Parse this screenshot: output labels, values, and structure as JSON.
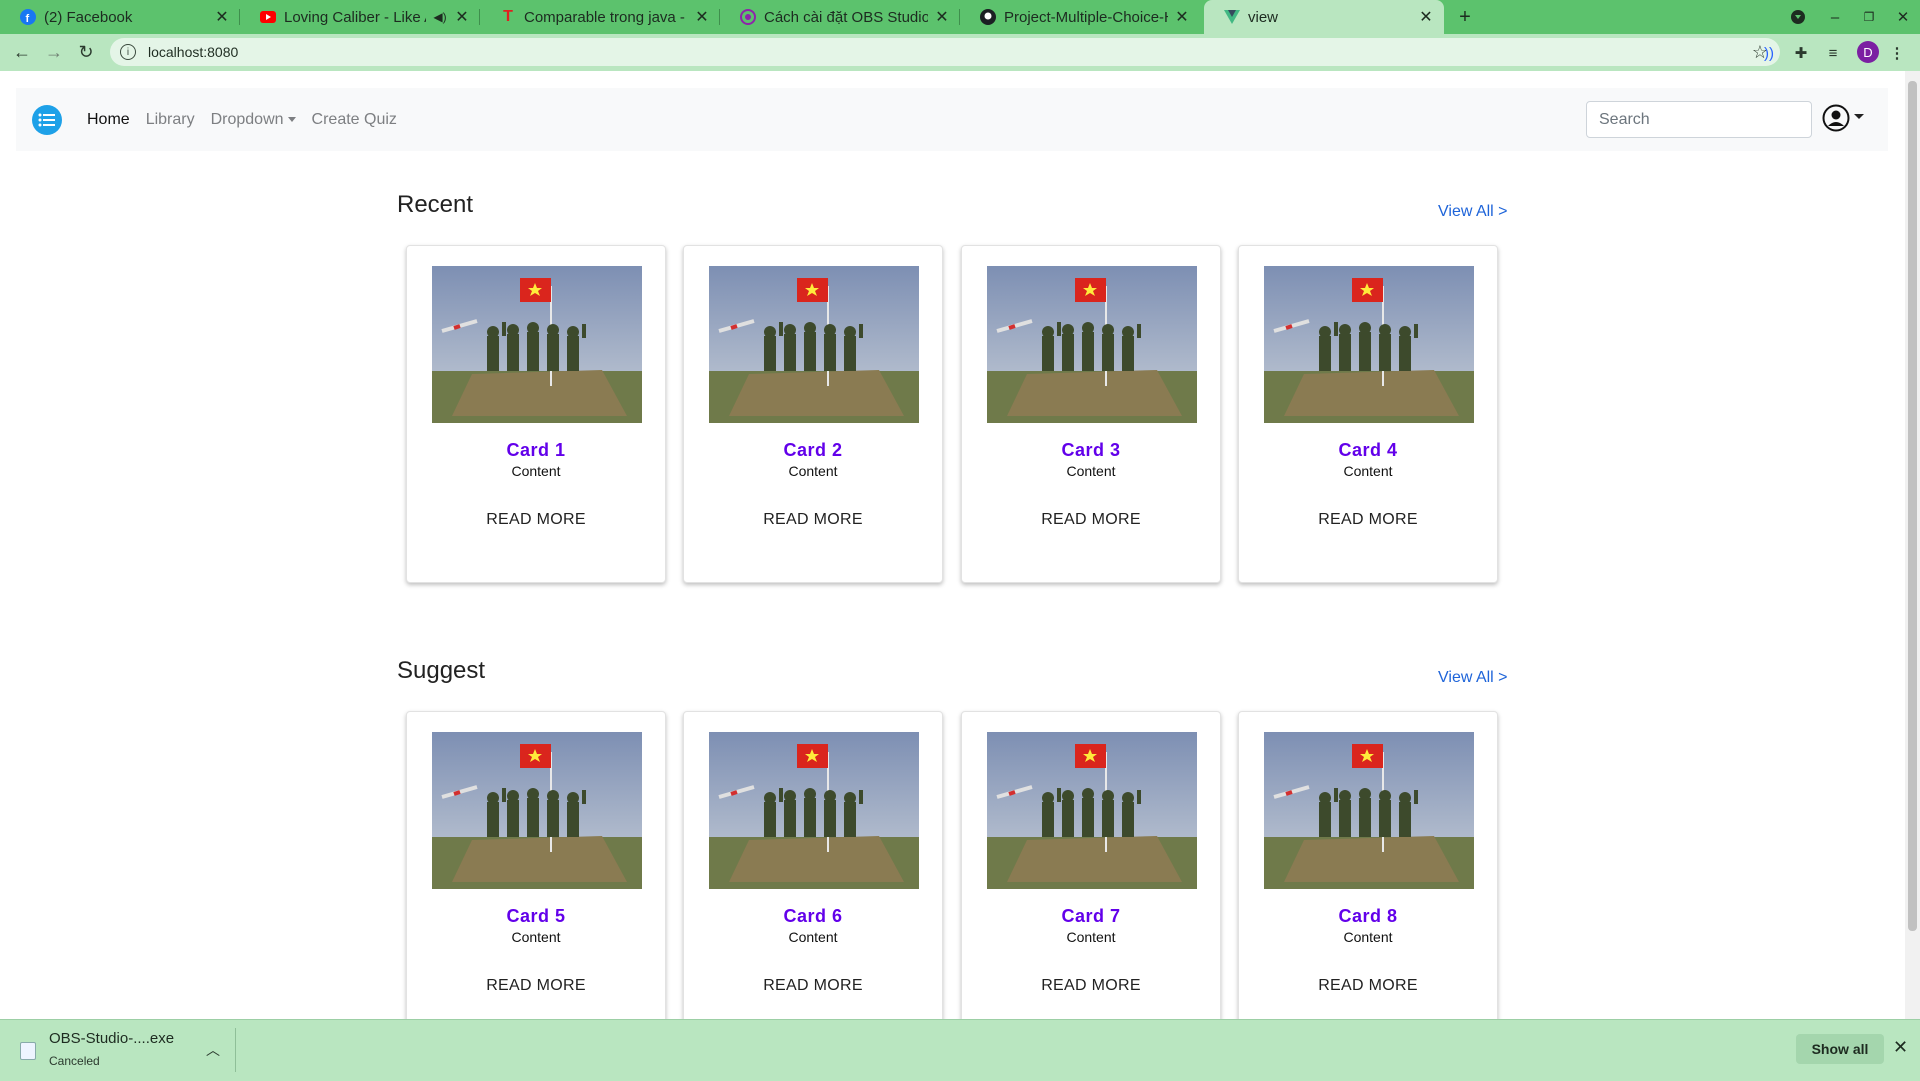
{
  "browser": {
    "tabs": [
      {
        "title": "(2) Facebook",
        "icon": "facebook-icon"
      },
      {
        "title": "Loving Caliber - Like A",
        "icon": "youtube-icon"
      },
      {
        "title": "Comparable trong java - V",
        "icon": "t-icon"
      },
      {
        "title": "Cách cài đặt OBS Studio t",
        "icon": "obs-icon"
      },
      {
        "title": "Project-Multiple-Choice-H",
        "icon": "github-icon"
      },
      {
        "title": "view",
        "icon": "vue-icon"
      }
    ],
    "new_tab": "+",
    "url": "localhost:8080",
    "profile_initial": "D"
  },
  "navbar": {
    "links": [
      "Home",
      "Library",
      "Dropdown",
      "Create Quiz"
    ],
    "search_placeholder": "Search"
  },
  "sections": [
    {
      "title": "Recent",
      "view_all": "View All >",
      "cards": [
        {
          "title": "Card 1",
          "content": "Content",
          "action": "READ MORE"
        },
        {
          "title": "Card 2",
          "content": "Content",
          "action": "READ MORE"
        },
        {
          "title": "Card 3",
          "content": "Content",
          "action": "READ MORE"
        },
        {
          "title": "Card 4",
          "content": "Content",
          "action": "READ MORE"
        }
      ]
    },
    {
      "title": "Suggest",
      "view_all": "View All >",
      "cards": [
        {
          "title": "Card 5",
          "content": "Content",
          "action": "READ MORE"
        },
        {
          "title": "Card 6",
          "content": "Content",
          "action": "READ MORE"
        },
        {
          "title": "Card 7",
          "content": "Content",
          "action": "READ MORE"
        },
        {
          "title": "Card 8",
          "content": "Content",
          "action": "READ MORE"
        }
      ]
    }
  ],
  "download": {
    "filename": "OBS-Studio-....exe",
    "status": "Canceled",
    "show_all": "Show all"
  },
  "colors": {
    "accent": "#6200ea",
    "link": "#1e64d9",
    "chrome": "#5cc26d"
  }
}
